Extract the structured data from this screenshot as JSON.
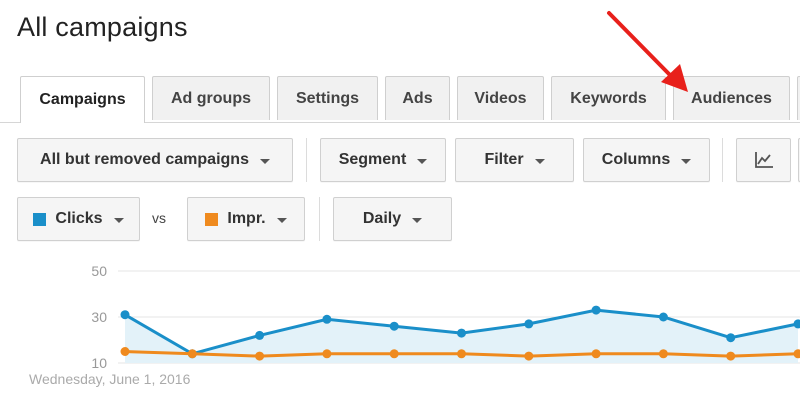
{
  "page": {
    "title": "All campaigns"
  },
  "tabs": [
    {
      "label": "Campaigns",
      "active": true
    },
    {
      "label": "Ad groups"
    },
    {
      "label": "Settings"
    },
    {
      "label": "Ads"
    },
    {
      "label": "Videos"
    },
    {
      "label": "Keywords"
    },
    {
      "label": "Audiences"
    }
  ],
  "toolbar": {
    "filter_dropdown": "All but removed campaigns",
    "segment": "Segment",
    "filter": "Filter",
    "columns": "Columns",
    "chart_toggle_icon": "line-chart-icon"
  },
  "metrics": {
    "metric1": {
      "label": "Clicks",
      "color": "#1a8fc9"
    },
    "vs": "vs",
    "metric2": {
      "label": "Impr.",
      "color": "#ef8a1e"
    },
    "granularity": "Daily"
  },
  "annotation": {
    "arrow_color": "#e8201b",
    "points_to": "Audiences"
  },
  "chart_data": {
    "type": "line",
    "yticks": [
      "50",
      "30",
      "10"
    ],
    "ylim": [
      10,
      50
    ],
    "series": [
      {
        "name": "Clicks",
        "color": "#1a8fc9",
        "fill": "#e3f2f9",
        "values": [
          31,
          14,
          22,
          29,
          26,
          23,
          27,
          33,
          30,
          21,
          27
        ]
      },
      {
        "name": "Impr.",
        "color": "#ef8a1e",
        "values": [
          15,
          14,
          13,
          14,
          14,
          14,
          13,
          14,
          14,
          13,
          14
        ]
      }
    ],
    "x_start_label": "Wednesday, June 1, 2016"
  }
}
